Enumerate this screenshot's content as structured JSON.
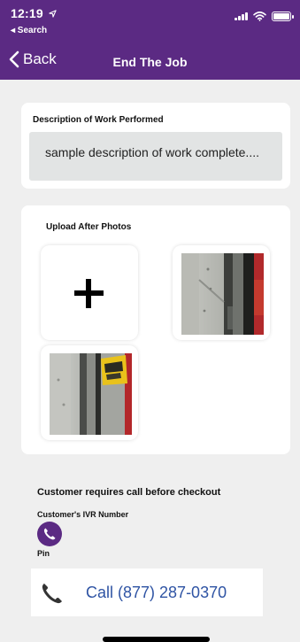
{
  "status_bar": {
    "time": "12:19",
    "back_app": "◂ Search"
  },
  "nav": {
    "back_label": "Back",
    "title": "End The Job"
  },
  "description": {
    "label": "Description of Work Performed",
    "value": "sample description of work complete...."
  },
  "upload": {
    "label": "Upload After Photos",
    "add_icon": "plus-icon",
    "photos": [
      "after-photo-door-frame",
      "after-photo-door-sign"
    ]
  },
  "customer_call": {
    "title": "Customer requires call before checkout",
    "ivr_label": "Customer's IVR Number",
    "pin_label": "Pin",
    "call_label": "Call (877) 287-0370"
  },
  "colors": {
    "brand": "#5b2a83",
    "link": "#2f54a4",
    "background": "#efefef"
  }
}
